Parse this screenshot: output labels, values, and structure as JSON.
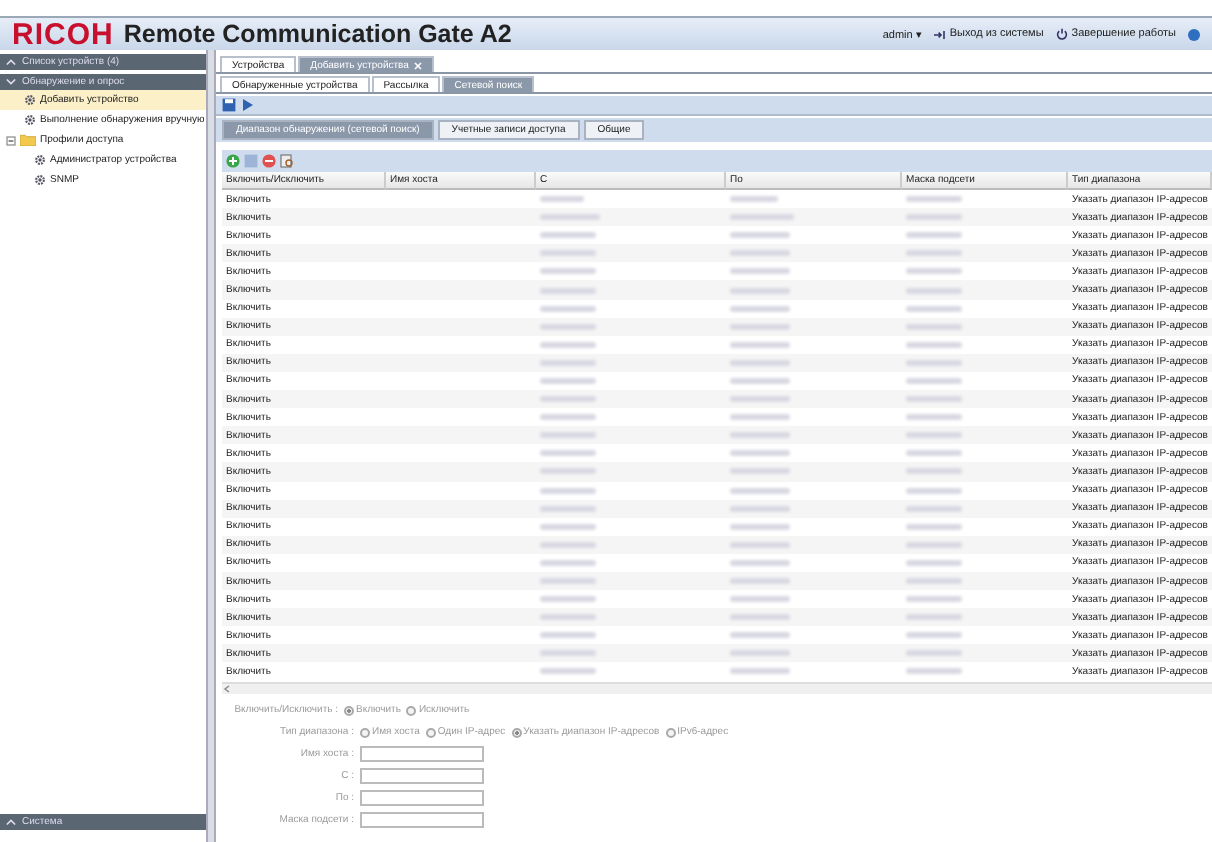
{
  "header": {
    "logo": "RICOH",
    "title": "Remote Communication Gate A2",
    "user": "admin",
    "user_caret": "▾",
    "logout": "Выход из системы",
    "shutdown": "Завершение работы"
  },
  "sidebar": {
    "sections": [
      {
        "label": "Список устройств (4)",
        "expanded": false
      },
      {
        "label": "Обнаружение и опрос",
        "expanded": true,
        "items": [
          {
            "kind": "cog",
            "label": "Добавить устройство",
            "selected": true
          },
          {
            "kind": "cog",
            "label": "Выполнение обнаружения вручную",
            "selected": false
          },
          {
            "kind": "folder",
            "label": "Профили доступа",
            "selected": false,
            "expanded": true,
            "children": [
              {
                "kind": "cog",
                "label": "Администратор устройства",
                "selected": false
              },
              {
                "kind": "cog",
                "label": "SNMP",
                "selected": false
              }
            ]
          }
        ]
      }
    ],
    "bottom_section": {
      "label": "Система",
      "expanded": false
    }
  },
  "tabs": [
    {
      "label": "Устройства",
      "selected": false,
      "closable": false
    },
    {
      "label": "Добавить устройства",
      "selected": true,
      "closable": true
    }
  ],
  "subtabs": [
    {
      "label": "Обнаруженные устройства",
      "selected": false
    },
    {
      "label": "Рассылка",
      "selected": false
    },
    {
      "label": "Сетевой поиск",
      "selected": true
    }
  ],
  "inner_tabs": [
    {
      "label": "Диапазон обнаружения (сетевой поиск)",
      "selected": true
    },
    {
      "label": "Учетные записи доступа",
      "selected": false
    },
    {
      "label": "Общие",
      "selected": false
    }
  ],
  "table": {
    "columns": [
      "Включить/Исключить",
      "Имя хоста",
      "С",
      "По",
      "Маска подсети",
      "Тип диапазона"
    ],
    "rows": [
      {
        "include": "Включить",
        "range_type": "Указать диапазон IP-адресов"
      },
      {
        "include": "Включить",
        "range_type": "Указать диапазон IP-адресов"
      },
      {
        "include": "Включить",
        "range_type": "Указать диапазон IP-адресов"
      },
      {
        "include": "Включить",
        "range_type": "Указать диапазон IP-адресов"
      },
      {
        "include": "Включить",
        "range_type": "Указать диапазон IP-адресов"
      },
      {
        "include": "Включить",
        "range_type": "Указать диапазон IP-адресов"
      },
      {
        "include": "Включить",
        "range_type": "Указать диапазон IP-адресов"
      },
      {
        "include": "Включить",
        "range_type": "Указать диапазон IP-адресов"
      },
      {
        "include": "Включить",
        "range_type": "Указать диапазон IP-адресов"
      },
      {
        "include": "Включить",
        "range_type": "Указать диапазон IP-адресов"
      },
      {
        "include": "Включить",
        "range_type": "Указать диапазон IP-адресов"
      },
      {
        "include": "Включить",
        "range_type": "Указать диапазон IP-адресов"
      },
      {
        "include": "Включить",
        "range_type": "Указать диапазон IP-адресов"
      },
      {
        "include": "Включить",
        "range_type": "Указать диапазон IP-адресов"
      },
      {
        "include": "Включить",
        "range_type": "Указать диапазон IP-адресов"
      },
      {
        "include": "Включить",
        "range_type": "Указать диапазон IP-адресов"
      },
      {
        "include": "Включить",
        "range_type": "Указать диапазон IP-адресов"
      },
      {
        "include": "Включить",
        "range_type": "Указать диапазон IP-адресов"
      },
      {
        "include": "Включить",
        "range_type": "Указать диапазон IP-адресов"
      },
      {
        "include": "Включить",
        "range_type": "Указать диапазон IP-адресов"
      },
      {
        "include": "Включить",
        "range_type": "Указать диапазон IP-адресов"
      },
      {
        "include": "Включить",
        "range_type": "Указать диапазон IP-адресов"
      },
      {
        "include": "Включить",
        "range_type": "Указать диапазон IP-адресов"
      },
      {
        "include": "Включить",
        "range_type": "Указать диапазон IP-адресов"
      },
      {
        "include": "Включить",
        "range_type": "Указать диапазон IP-адресов"
      },
      {
        "include": "Включить",
        "range_type": "Указать диапазон IP-адресов"
      },
      {
        "include": "Включить",
        "range_type": "Указать диапазон IP-адресов"
      }
    ]
  },
  "form": {
    "disabled": true,
    "include": {
      "label": "Включить/Исключить :",
      "options": [
        {
          "label": "Включить",
          "selected": true
        },
        {
          "label": "Исключить",
          "selected": false
        }
      ]
    },
    "range_type": {
      "label": "Тип диапазона :",
      "options": [
        {
          "label": "Имя хоста",
          "selected": false
        },
        {
          "label": "Один IP-адрес",
          "selected": false
        },
        {
          "label": "Указать диапазон IP-адресов",
          "selected": true
        },
        {
          "label": "IPv6-адрес",
          "selected": false
        }
      ]
    },
    "fields": [
      {
        "label": "Имя хоста :"
      },
      {
        "label": "С :"
      },
      {
        "label": "По :"
      },
      {
        "label": "Маска подсети :"
      }
    ]
  }
}
